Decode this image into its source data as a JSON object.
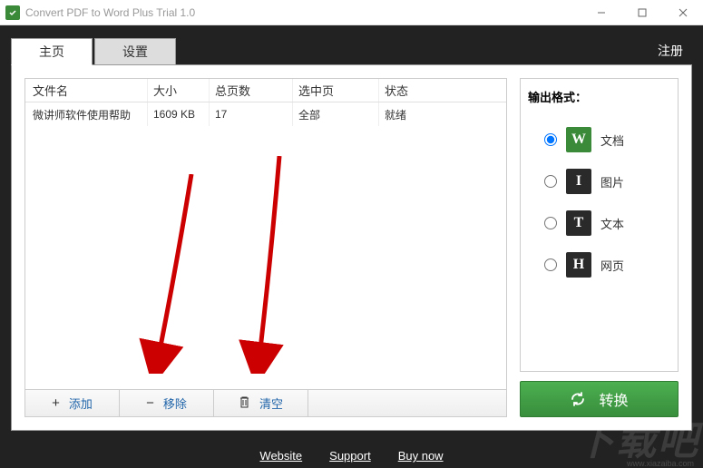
{
  "window": {
    "title": "Convert PDF to Word Plus Trial 1.0"
  },
  "tabs": {
    "main": "主页",
    "settings": "设置",
    "register": "注册"
  },
  "table": {
    "headers": {
      "name": "文件名",
      "size": "大小",
      "pages": "总页数",
      "selected": "选中页",
      "status": "状态"
    },
    "rows": [
      {
        "name": "微讲师软件使用帮助",
        "size": "1609 KB",
        "pages": "17",
        "selected": "全部",
        "status": "就绪"
      }
    ]
  },
  "toolbar": {
    "add": "添加",
    "remove": "移除",
    "clear": "清空"
  },
  "output": {
    "title": "输出格式：",
    "options": [
      {
        "icon": "W",
        "label": "文档",
        "checked": true,
        "iconClass": "green"
      },
      {
        "icon": "I",
        "label": "图片",
        "checked": false,
        "iconClass": "dark"
      },
      {
        "icon": "T",
        "label": "文本",
        "checked": false,
        "iconClass": "dark"
      },
      {
        "icon": "H",
        "label": "网页",
        "checked": false,
        "iconClass": "dark"
      }
    ]
  },
  "convert": "转换",
  "footer": {
    "website": "Website",
    "support": "Support",
    "buy": "Buy now"
  },
  "watermark": "下载吧",
  "watermark_sub": "www.xiazaiba.com"
}
